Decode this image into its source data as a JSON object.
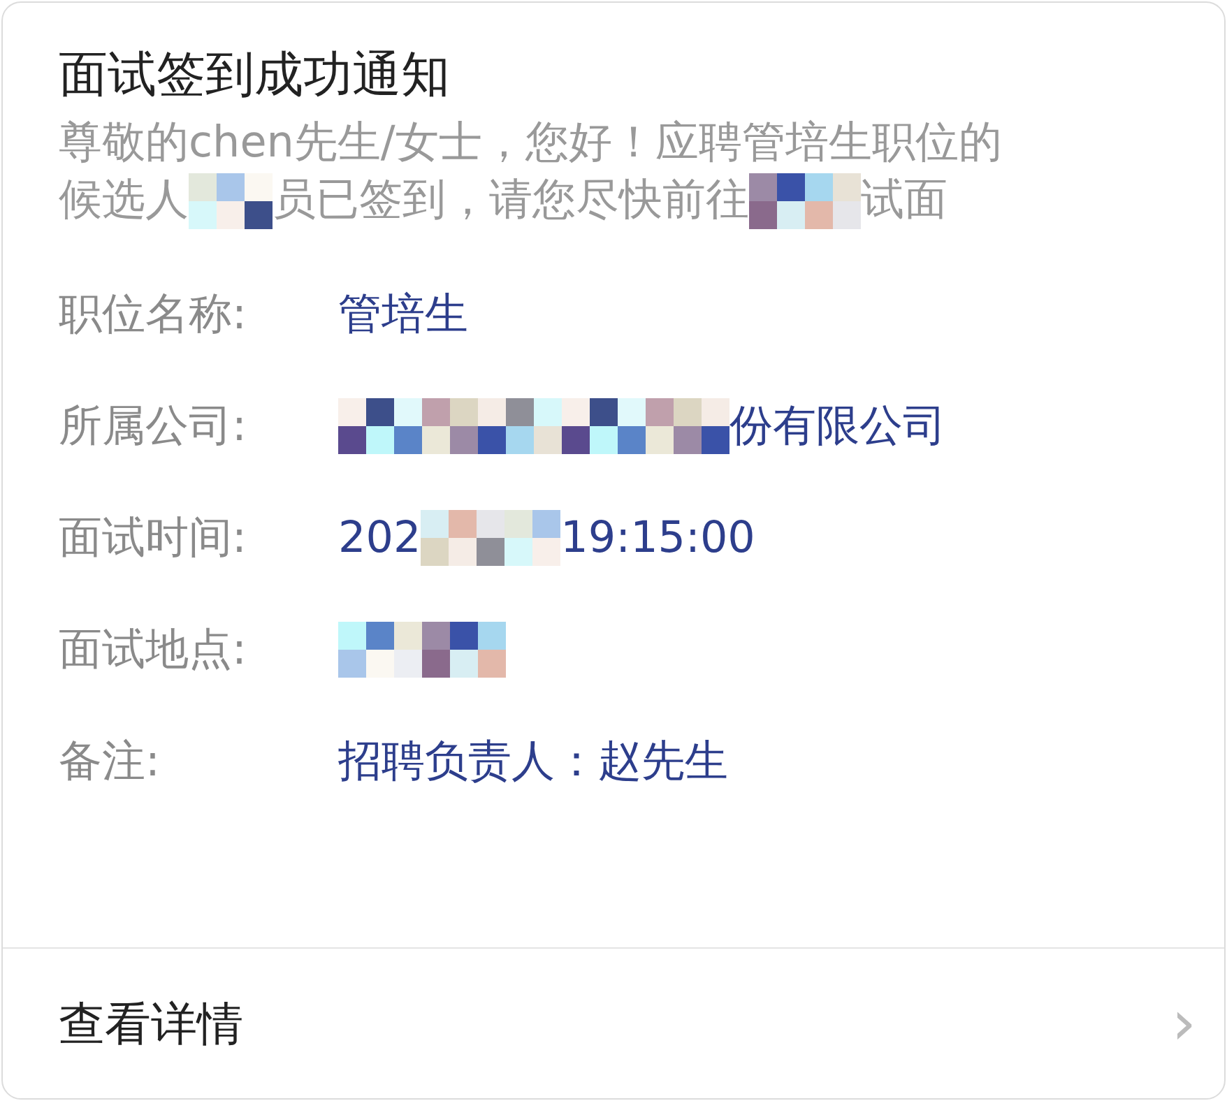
{
  "title": "面试签到成功通知",
  "message": [
    {
      "kind": "text",
      "text": "尊敬的chen先生/女士，您好！应聘管培生职位的"
    },
    {
      "kind": "break"
    },
    {
      "kind": "text",
      "text": "候选人"
    },
    {
      "kind": "redacted"
    },
    {
      "kind": "text",
      "text": "员已签到，请您尽快前往"
    },
    {
      "kind": "redacted"
    },
    {
      "kind": "text",
      "text": "试面"
    }
  ],
  "fields": [
    {
      "label": "职位名称:",
      "value": [
        {
          "kind": "text",
          "text": "管培生"
        }
      ]
    },
    {
      "label": "所属公司:",
      "value": [
        {
          "kind": "redacted"
        },
        {
          "kind": "text",
          "text": "份有限公司"
        }
      ]
    },
    {
      "label": "面试时间:",
      "value": [
        {
          "kind": "text",
          "text": "202"
        },
        {
          "kind": "redacted"
        },
        {
          "kind": "text",
          "text": "19:15:00"
        }
      ]
    },
    {
      "label": "面试地点:",
      "value": [
        {
          "kind": "redacted"
        }
      ]
    },
    {
      "label": "备注:",
      "value": [
        {
          "kind": "text",
          "text": "招聘负责人：赵先生"
        }
      ]
    }
  ],
  "footer": {
    "label": "查看详情",
    "chevron": "›"
  }
}
